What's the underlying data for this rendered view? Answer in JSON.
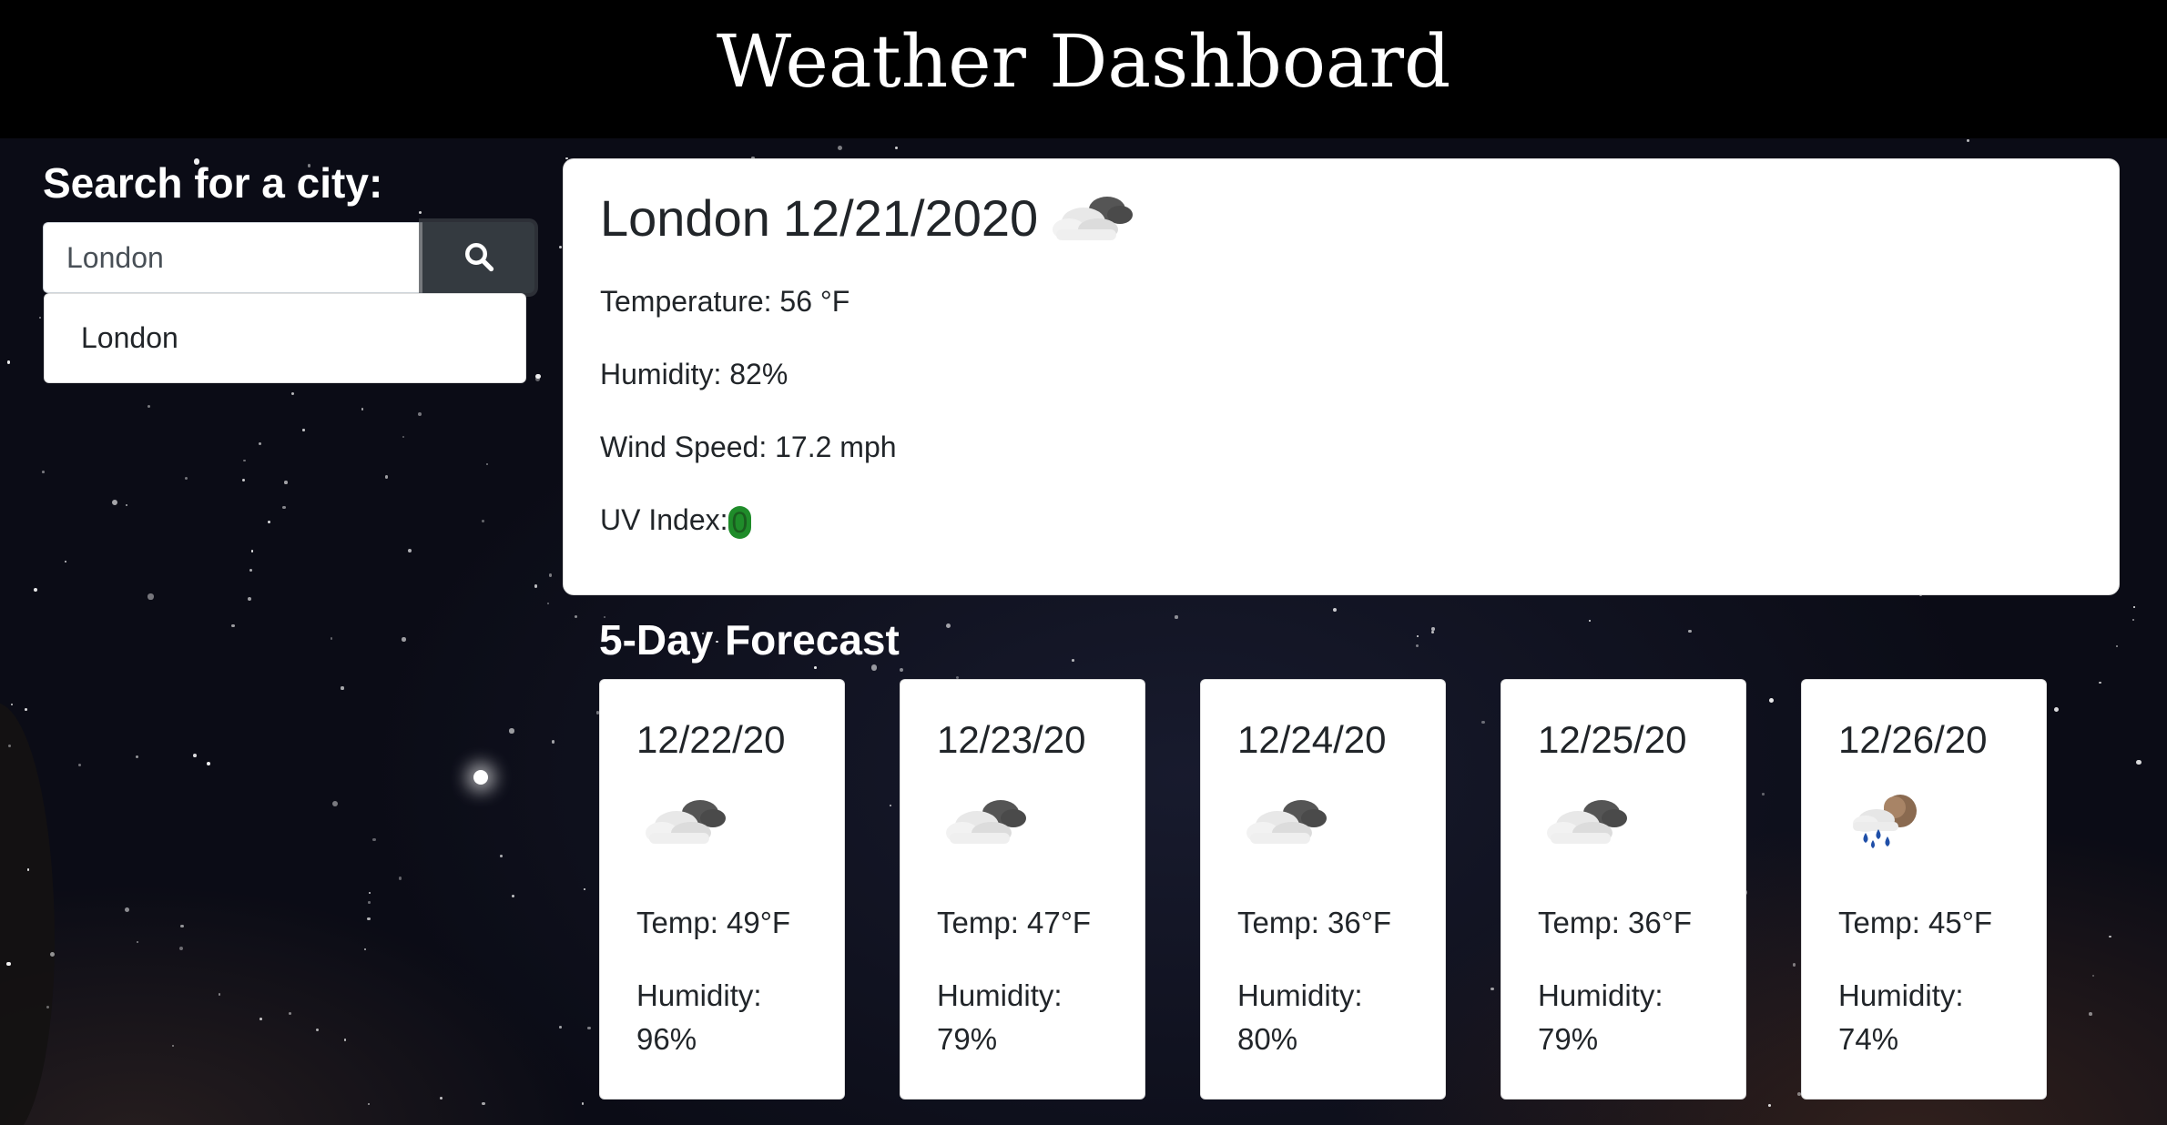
{
  "header": {
    "title": "Weather Dashboard"
  },
  "search": {
    "heading": "Search for a city:",
    "input_value": "London",
    "button_icon": "search-icon",
    "history": [
      "London"
    ]
  },
  "current": {
    "city": "London",
    "date": "12/21/2020",
    "icon": "partly-cloudy-icon",
    "temperature": "Temperature: 56 °F",
    "humidity": "Humidity: 82%",
    "wind": "Wind Speed: 17.2 mph",
    "uv_label": "UV Index:",
    "uv_value": "0",
    "uv_color": "#1f8c2a"
  },
  "forecast": {
    "heading": "5-Day Forecast",
    "days": [
      {
        "date": "12/22/20",
        "icon": "partly-cloudy-icon",
        "temp": "Temp: 49°F",
        "humidity_label": "Humidity:",
        "humidity": "96%"
      },
      {
        "date": "12/23/20",
        "icon": "partly-cloudy-icon",
        "temp": "Temp: 47°F",
        "humidity_label": "Humidity:",
        "humidity": "79%"
      },
      {
        "date": "12/24/20",
        "icon": "partly-cloudy-icon",
        "temp": "Temp: 36°F",
        "humidity_label": "Humidity:",
        "humidity": "80%"
      },
      {
        "date": "12/25/20",
        "icon": "partly-cloudy-icon",
        "temp": "Temp: 36°F",
        "humidity_label": "Humidity:",
        "humidity": "79%"
      },
      {
        "date": "12/26/20",
        "icon": "rain-icon",
        "temp": "Temp: 45°F",
        "humidity_label": "Humidity:",
        "humidity": "74%"
      }
    ]
  }
}
